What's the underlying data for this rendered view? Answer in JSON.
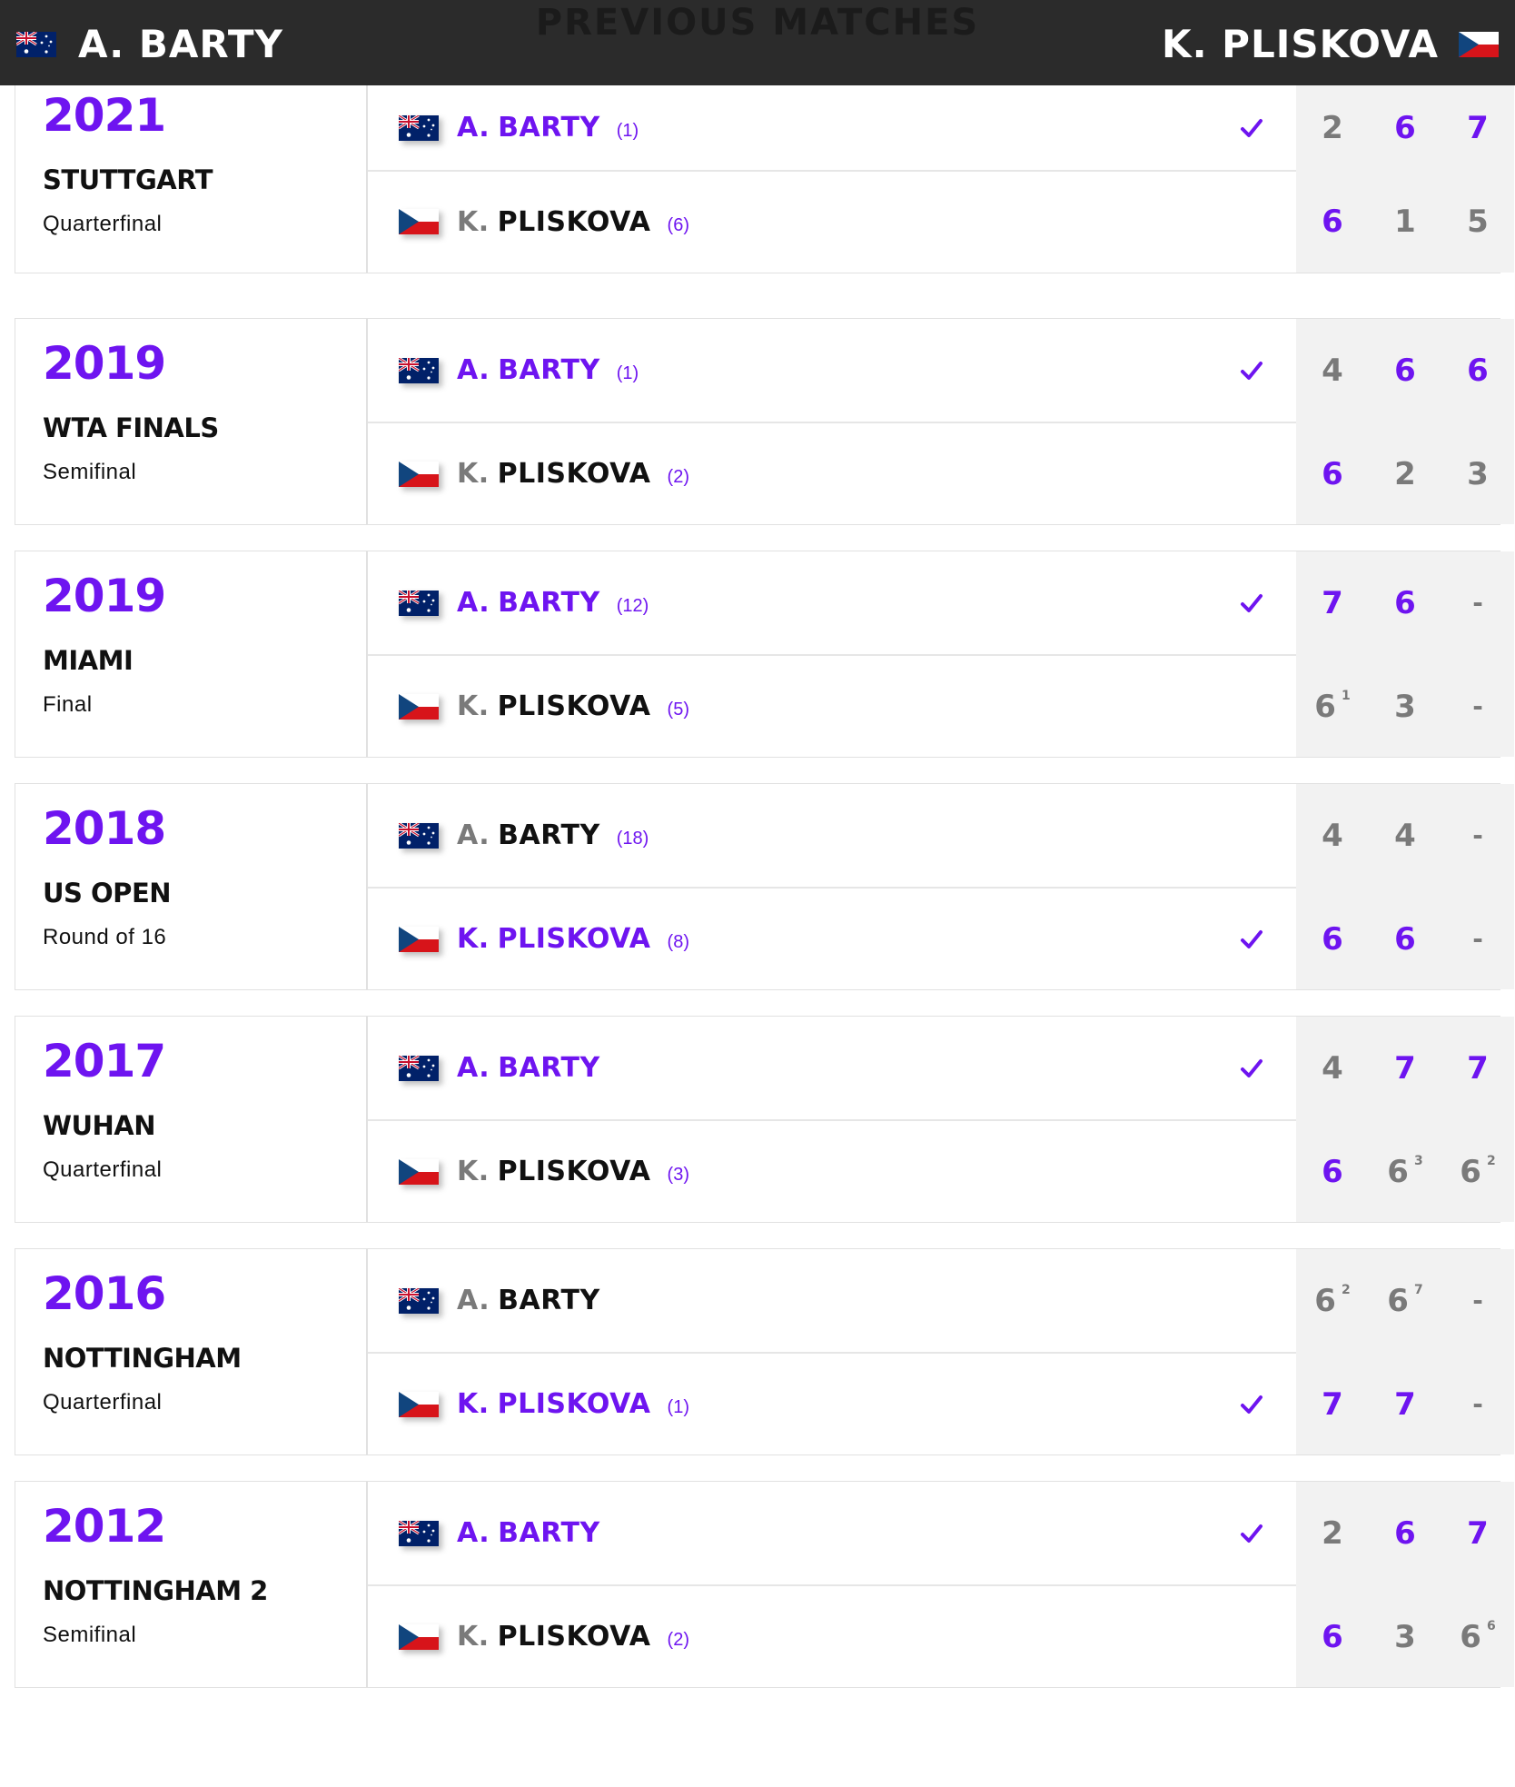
{
  "header": {
    "title": "PREVIOUS MATCHES",
    "player1": "A. BARTY",
    "player2": "K. PLISKOVA",
    "player1_flag": "australia-flag",
    "player2_flag": "czech-flag"
  },
  "colors": {
    "accent": "#6e14f0",
    "header_bg": "#2b2b2b",
    "score_col": "#f2f2f2",
    "muted": "#7a7a7a"
  },
  "matches": [
    {
      "year": "2021",
      "event": "STUTTGART",
      "round": "Quarterfinal",
      "p1": {
        "initial": "A.",
        "last": "BARTY",
        "seed": "(1)",
        "winner": true,
        "scores": [
          {
            "v": "2",
            "w": false,
            "tb": ""
          },
          {
            "v": "6",
            "w": true,
            "tb": ""
          },
          {
            "v": "7",
            "w": true,
            "tb": ""
          }
        ]
      },
      "p2": {
        "initial": "K.",
        "last": "PLISKOVA",
        "seed": "(6)",
        "winner": false,
        "scores": [
          {
            "v": "6",
            "w": true,
            "tb": ""
          },
          {
            "v": "1",
            "w": false,
            "tb": ""
          },
          {
            "v": "5",
            "w": false,
            "tb": ""
          }
        ]
      }
    },
    {
      "year": "2019",
      "event": "WTA FINALS",
      "round": "Semifinal",
      "p1": {
        "initial": "A.",
        "last": "BARTY",
        "seed": "(1)",
        "winner": true,
        "scores": [
          {
            "v": "4",
            "w": false,
            "tb": ""
          },
          {
            "v": "6",
            "w": true,
            "tb": ""
          },
          {
            "v": "6",
            "w": true,
            "tb": ""
          }
        ]
      },
      "p2": {
        "initial": "K.",
        "last": "PLISKOVA",
        "seed": "(2)",
        "winner": false,
        "scores": [
          {
            "v": "6",
            "w": true,
            "tb": ""
          },
          {
            "v": "2",
            "w": false,
            "tb": ""
          },
          {
            "v": "3",
            "w": false,
            "tb": ""
          }
        ]
      }
    },
    {
      "year": "2019",
      "event": "MIAMI",
      "round": "Final",
      "p1": {
        "initial": "A.",
        "last": "BARTY",
        "seed": "(12)",
        "winner": true,
        "scores": [
          {
            "v": "7",
            "w": true,
            "tb": ""
          },
          {
            "v": "6",
            "w": true,
            "tb": ""
          },
          {
            "v": "-",
            "w": false,
            "tb": ""
          }
        ]
      },
      "p2": {
        "initial": "K.",
        "last": "PLISKOVA",
        "seed": "(5)",
        "winner": false,
        "scores": [
          {
            "v": "6",
            "w": false,
            "tb": "1"
          },
          {
            "v": "3",
            "w": false,
            "tb": ""
          },
          {
            "v": "-",
            "w": false,
            "tb": ""
          }
        ]
      }
    },
    {
      "year": "2018",
      "event": "US OPEN",
      "round": "Round of 16",
      "p1": {
        "initial": "A.",
        "last": "BARTY",
        "seed": "(18)",
        "winner": false,
        "scores": [
          {
            "v": "4",
            "w": false,
            "tb": ""
          },
          {
            "v": "4",
            "w": false,
            "tb": ""
          },
          {
            "v": "-",
            "w": false,
            "tb": ""
          }
        ]
      },
      "p2": {
        "initial": "K.",
        "last": "PLISKOVA",
        "seed": "(8)",
        "winner": true,
        "scores": [
          {
            "v": "6",
            "w": true,
            "tb": ""
          },
          {
            "v": "6",
            "w": true,
            "tb": ""
          },
          {
            "v": "-",
            "w": false,
            "tb": ""
          }
        ]
      }
    },
    {
      "year": "2017",
      "event": "WUHAN",
      "round": "Quarterfinal",
      "p1": {
        "initial": "A.",
        "last": "BARTY",
        "seed": "",
        "winner": true,
        "scores": [
          {
            "v": "4",
            "w": false,
            "tb": ""
          },
          {
            "v": "7",
            "w": true,
            "tb": ""
          },
          {
            "v": "7",
            "w": true,
            "tb": ""
          }
        ]
      },
      "p2": {
        "initial": "K.",
        "last": "PLISKOVA",
        "seed": "(3)",
        "winner": false,
        "scores": [
          {
            "v": "6",
            "w": true,
            "tb": ""
          },
          {
            "v": "6",
            "w": false,
            "tb": "3"
          },
          {
            "v": "6",
            "w": false,
            "tb": "2"
          }
        ]
      }
    },
    {
      "year": "2016",
      "event": "NOTTINGHAM",
      "round": "Quarterfinal",
      "p1": {
        "initial": "A.",
        "last": "BARTY",
        "seed": "",
        "winner": false,
        "scores": [
          {
            "v": "6",
            "w": false,
            "tb": "2"
          },
          {
            "v": "6",
            "w": false,
            "tb": "7"
          },
          {
            "v": "-",
            "w": false,
            "tb": ""
          }
        ]
      },
      "p2": {
        "initial": "K.",
        "last": "PLISKOVA",
        "seed": "(1)",
        "winner": true,
        "scores": [
          {
            "v": "7",
            "w": true,
            "tb": ""
          },
          {
            "v": "7",
            "w": true,
            "tb": ""
          },
          {
            "v": "-",
            "w": false,
            "tb": ""
          }
        ]
      }
    },
    {
      "year": "2012",
      "event": "NOTTINGHAM 2",
      "round": "Semifinal",
      "p1": {
        "initial": "A.",
        "last": "BARTY",
        "seed": "",
        "winner": true,
        "scores": [
          {
            "v": "2",
            "w": false,
            "tb": ""
          },
          {
            "v": "6",
            "w": true,
            "tb": ""
          },
          {
            "v": "7",
            "w": true,
            "tb": ""
          }
        ]
      },
      "p2": {
        "initial": "K.",
        "last": "PLISKOVA",
        "seed": "(2)",
        "winner": false,
        "scores": [
          {
            "v": "6",
            "w": true,
            "tb": ""
          },
          {
            "v": "3",
            "w": false,
            "tb": ""
          },
          {
            "v": "6",
            "w": false,
            "tb": "6"
          }
        ]
      }
    }
  ]
}
